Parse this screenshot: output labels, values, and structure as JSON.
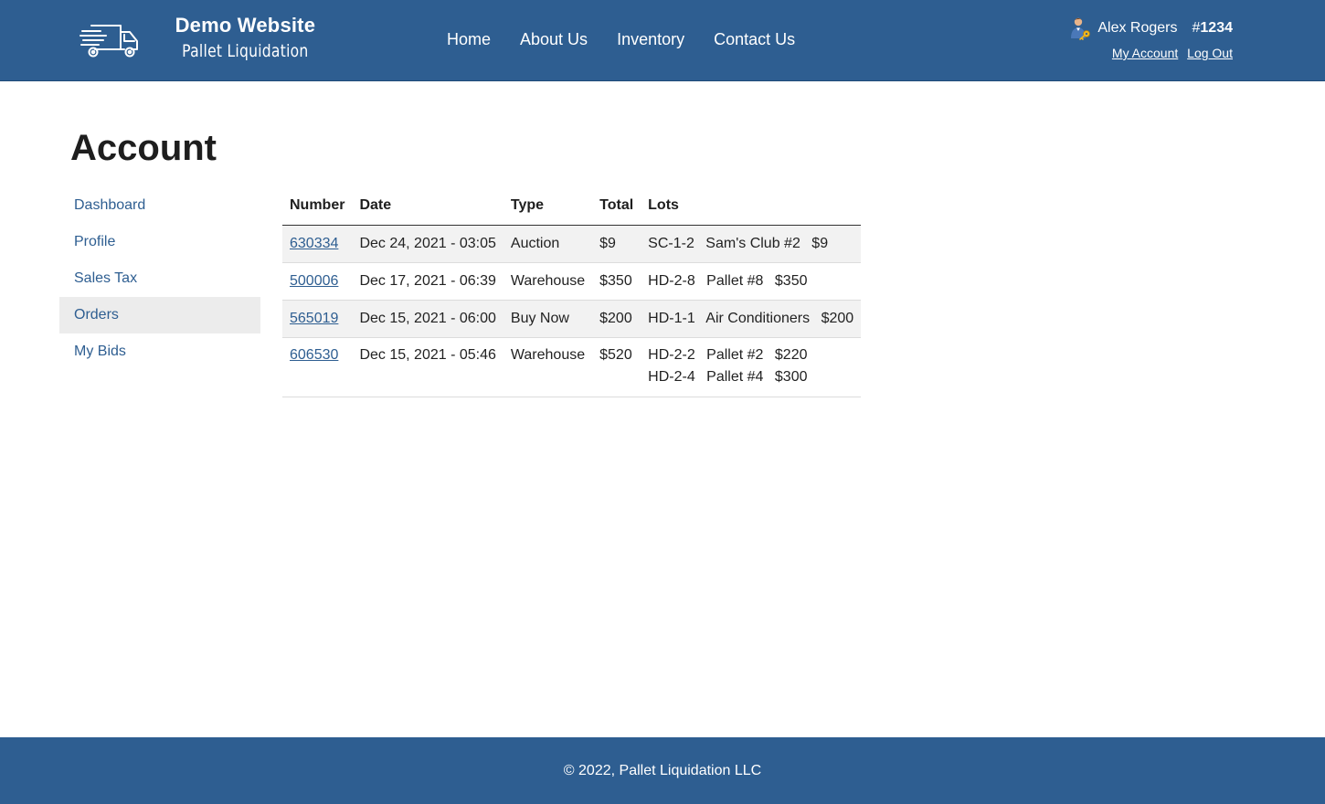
{
  "header": {
    "logo_title": "Demo Website",
    "logo_subtitle": "Pallet Liquidation",
    "logo_icon": "truck-icon",
    "nav": [
      {
        "label": "Home"
      },
      {
        "label": "About Us"
      },
      {
        "label": "Inventory"
      },
      {
        "label": "Contact Us"
      }
    ],
    "user": {
      "name": "Alex Rogers",
      "number_hash": "#",
      "number": "1234",
      "avatar_icon": "user-key-icon",
      "my_account": "My Account",
      "log_out": "Log Out"
    }
  },
  "page": {
    "title": "Account"
  },
  "sidebar": {
    "items": [
      {
        "label": "Dashboard",
        "active": false
      },
      {
        "label": "Profile",
        "active": false
      },
      {
        "label": "Sales Tax",
        "active": false
      },
      {
        "label": "Orders",
        "active": true
      },
      {
        "label": "My Bids",
        "active": false
      }
    ]
  },
  "orders": {
    "columns": [
      "Number",
      "Date",
      "Type",
      "Total",
      "Lots"
    ],
    "rows": [
      {
        "number": "630334",
        "date": "Dec 24, 2021 - 03:05",
        "type": "Auction",
        "total": "$9",
        "lots": [
          {
            "code": "SC-1-2",
            "name": "Sam's Club #2",
            "price": "$9"
          }
        ]
      },
      {
        "number": "500006",
        "date": "Dec 17, 2021 - 06:39",
        "type": "Warehouse",
        "total": "$350",
        "lots": [
          {
            "code": "HD-2-8",
            "name": "Pallet #8",
            "price": "$350"
          }
        ]
      },
      {
        "number": "565019",
        "date": "Dec 15, 2021 - 06:00",
        "type": "Buy Now",
        "total": "$200",
        "lots": [
          {
            "code": "HD-1-1",
            "name": "Air Conditioners",
            "price": "$200"
          }
        ]
      },
      {
        "number": "606530",
        "date": "Dec 15, 2021 - 05:46",
        "type": "Warehouse",
        "total": "$520",
        "lots": [
          {
            "code": "HD-2-2",
            "name": "Pallet #2",
            "price": "$220"
          },
          {
            "code": "HD-2-4",
            "name": "Pallet #4",
            "price": "$300"
          }
        ]
      }
    ]
  },
  "footer": {
    "text": "© 2022, Pallet Liquidation LLC"
  },
  "colors": {
    "brand": "#2e5e91",
    "active_bg": "#ececec",
    "stripe_bg": "#f2f2f2"
  }
}
